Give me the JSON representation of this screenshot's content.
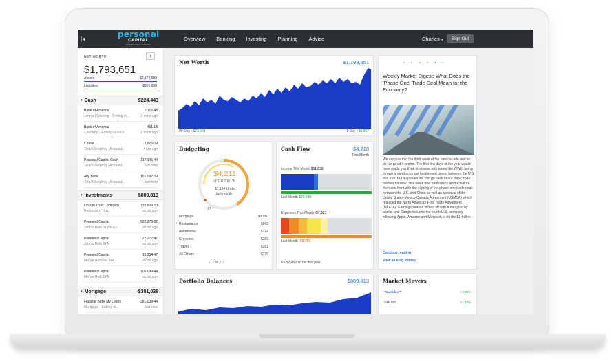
{
  "nav": {
    "logo_line1": "personal",
    "logo_line2": "CAPITAL",
    "logo_line3": "AN EMPOWER COMPANY",
    "items": [
      "Overview",
      "Banking",
      "Investing",
      "Planning",
      "Advice"
    ],
    "user": "Charles",
    "signout": "Sign Out"
  },
  "sidebar": {
    "net_worth_label": "NET WORTH",
    "add_button": "+",
    "net_worth_value": "$1,793,651",
    "assets_label": "Assets",
    "assets_value": "$2,174,689",
    "liabilities_label": "Liabilities",
    "liabilities_value": "-$381,038",
    "cash": {
      "label": "Cash",
      "value": "$224,443",
      "accounts": [
        {
          "name": "Bank of America",
          "value": "2,113.48",
          "sub": "John's Checking - Ending in...",
          "time": "2 mins ago"
        },
        {
          "name": "Bank of America",
          "value": "461.18",
          "sub": "Checking - Ending in 0000",
          "time": "2 mins ago"
        },
        {
          "name": "Chase",
          "value": "3,626.09",
          "sub": "Total Checking - Account...",
          "time": "4 hrs ago"
        },
        {
          "name": "Personal Capital Cash",
          "value": "117,145.44",
          "sub": "Total Checking - Account...",
          "time": "Just now"
        },
        {
          "name": "Ally Bank",
          "value": "101,097.39",
          "sub": "Total Checking - Account...",
          "time": "Just now"
        }
      ]
    },
    "investments": {
      "label": "Investments",
      "value": "$809,813",
      "accounts": [
        {
          "name": "Lincoln Trust Company",
          "value": "139,809.30",
          "sub": "Retirement Trust",
          "time": "a min ago"
        },
        {
          "name": "Personal Capital",
          "value": "522,379.62",
          "sub": "John's Roth JTWROS",
          "time": "a min ago"
        },
        {
          "name": "Personal Capital",
          "value": "27,272.47",
          "sub": "John's Roth IRA",
          "time": "a min ago"
        },
        {
          "name": "Personal Capital",
          "value": "15,254.47",
          "sub": "Mary's Rollover IRA",
          "time": "a min ago"
        },
        {
          "name": "Personal Capital",
          "value": "105,099.44",
          "sub": "Mary's Roth IRA",
          "time": "a min ago"
        }
      ]
    },
    "mortgage": {
      "label": "Mortgage",
      "value": "-$381,038",
      "accounts": [
        {
          "name": "Flagstar Bank My Loans",
          "value": "-381,038.44",
          "sub": "Mortgage - Ending in...",
          "time": "Just now"
        }
      ]
    }
  },
  "networth_panel": {
    "title": "Net Worth",
    "value": "$1,793,651",
    "left_label": "90-Day",
    "left_change": "+$73,684",
    "right_label": "1-Day",
    "right_change": "+$6,967",
    "fill_color": "#1a3cc6"
  },
  "budget_panel": {
    "title": "Budgeting",
    "spent": "$4,211",
    "of_total": "of $10,200",
    "under_amount": "$7,134 Under",
    "period": "last month",
    "day_marker": "17",
    "rows": [
      {
        "label": "Mortgage",
        "value": "$3,550"
      },
      {
        "label": "Restaurants",
        "value": "$665"
      },
      {
        "label": "Automotive",
        "value": "$374"
      },
      {
        "label": "Groceries",
        "value": "$283"
      },
      {
        "label": "Travel",
        "value": "$181"
      },
      {
        "label": "All Others",
        "value": "$779"
      }
    ],
    "pagination": "1 of 2"
  },
  "cashflow_panel": {
    "title": "Cash Flow",
    "value": "$4,210",
    "period": "This Month",
    "income_label": "Income This Month",
    "income_value": "$11,838",
    "income_last": "Last Month",
    "income_last_value": "$20,598",
    "expense_label": "Expenses This Month",
    "expense_value": "-$7,627",
    "expense_last": "Last Month",
    "expense_last_value": "-$9,750",
    "footer": "Up $2,459 so far this year"
  },
  "blog_panel": {
    "title": "Weekly Market Digest: What Does the 'Phase One' Trade Deal Mean for the Economy?",
    "body": "We are now into the third week of the new decade and so far, so good it seems. The first few days of the year would have made you think otherwise with terms like WWIII being thrown around amongst heightened unrest between the U.S. and Iran, but it appears we can go back to our Baby Yoda memes for now. This week was particularly productive on the trade front with the signing of the phase-one trade deal between the U.S. and China as well as approval of the United States-Mexico-Canada Agreement (USMCA) which replaced the North American Free Trade Agreement (NAFTA). Earnings season kicked off with a bang led by banks, and Google became the fourth U.S. company following Apple, Amazon and Microsoft to hit the $1 trillion",
    "continue": "Continue reading",
    "view_all": "View all blog entries"
  },
  "portfolio_panel": {
    "title": "Portfolio Balances",
    "value": "$809,813"
  },
  "movers_panel": {
    "title": "Market Movers",
    "rows": [
      {
        "name": "You Index™",
        "change": "+2.30%"
      },
      {
        "name": "S&P 500",
        "change": "+1.87%"
      }
    ]
  }
}
